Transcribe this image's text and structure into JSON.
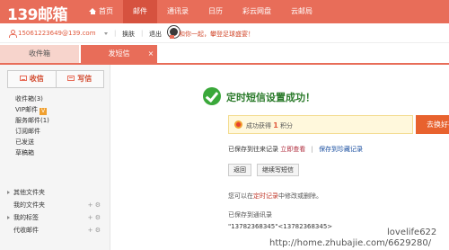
{
  "app": {
    "logo": "139邮箱"
  },
  "nav": {
    "items": [
      {
        "label": "首页"
      },
      {
        "label": "邮件"
      },
      {
        "label": "通讯录"
      },
      {
        "label": "日历"
      },
      {
        "label": "彩云网盘"
      },
      {
        "label": "云邮局"
      }
    ],
    "active": "邮件"
  },
  "userbar": {
    "email": "15061223649@139.com",
    "switch": "换肤",
    "logout": "退出",
    "promo": "和你一起，攀登足球盛宴！"
  },
  "tabs": {
    "inbox": "收件箱",
    "sms": "发短信",
    "close": "×"
  },
  "sidebar": {
    "receive": "收信",
    "write": "写信",
    "folders": [
      {
        "label": "收件箱(3)"
      },
      {
        "label": "VIP邮件"
      },
      {
        "label": "服务邮件(1)"
      },
      {
        "label": "订阅邮件"
      },
      {
        "label": "已发送"
      },
      {
        "label": "草稿箱"
      }
    ],
    "vip_badge": "V",
    "groups": [
      {
        "label": "其他文件夹"
      },
      {
        "label": "我的文件夹"
      },
      {
        "label": "我的标签"
      },
      {
        "label": "代收邮件"
      }
    ]
  },
  "main": {
    "success_title": "定时短信设置成功！",
    "reward_prefix": "成功获得",
    "reward_points": "1",
    "reward_suffix": "积分",
    "exchange_button": "去换好礼",
    "saved_prefix": "已保存到往来记录",
    "view_now": "立即查看",
    "save_to_collection": "保存到珍藏记录",
    "back_button": "返回",
    "continue_button": "继续写短信",
    "note_prefix": "您可以在",
    "note_link": "定时记录",
    "note_suffix": "中修改或删除。",
    "saved_contacts_label": "已保存到通讯录",
    "contacts": "\"13782368345\"<13782368345>"
  },
  "watermark": {
    "line1": "lovelife622",
    "line2": "http://home.zhubajie.com/6629280/"
  },
  "colors": {
    "brand": "#e86d59",
    "brand_dark": "#d6523f",
    "success": "#3aa83a",
    "exchange": "#e8622e"
  }
}
